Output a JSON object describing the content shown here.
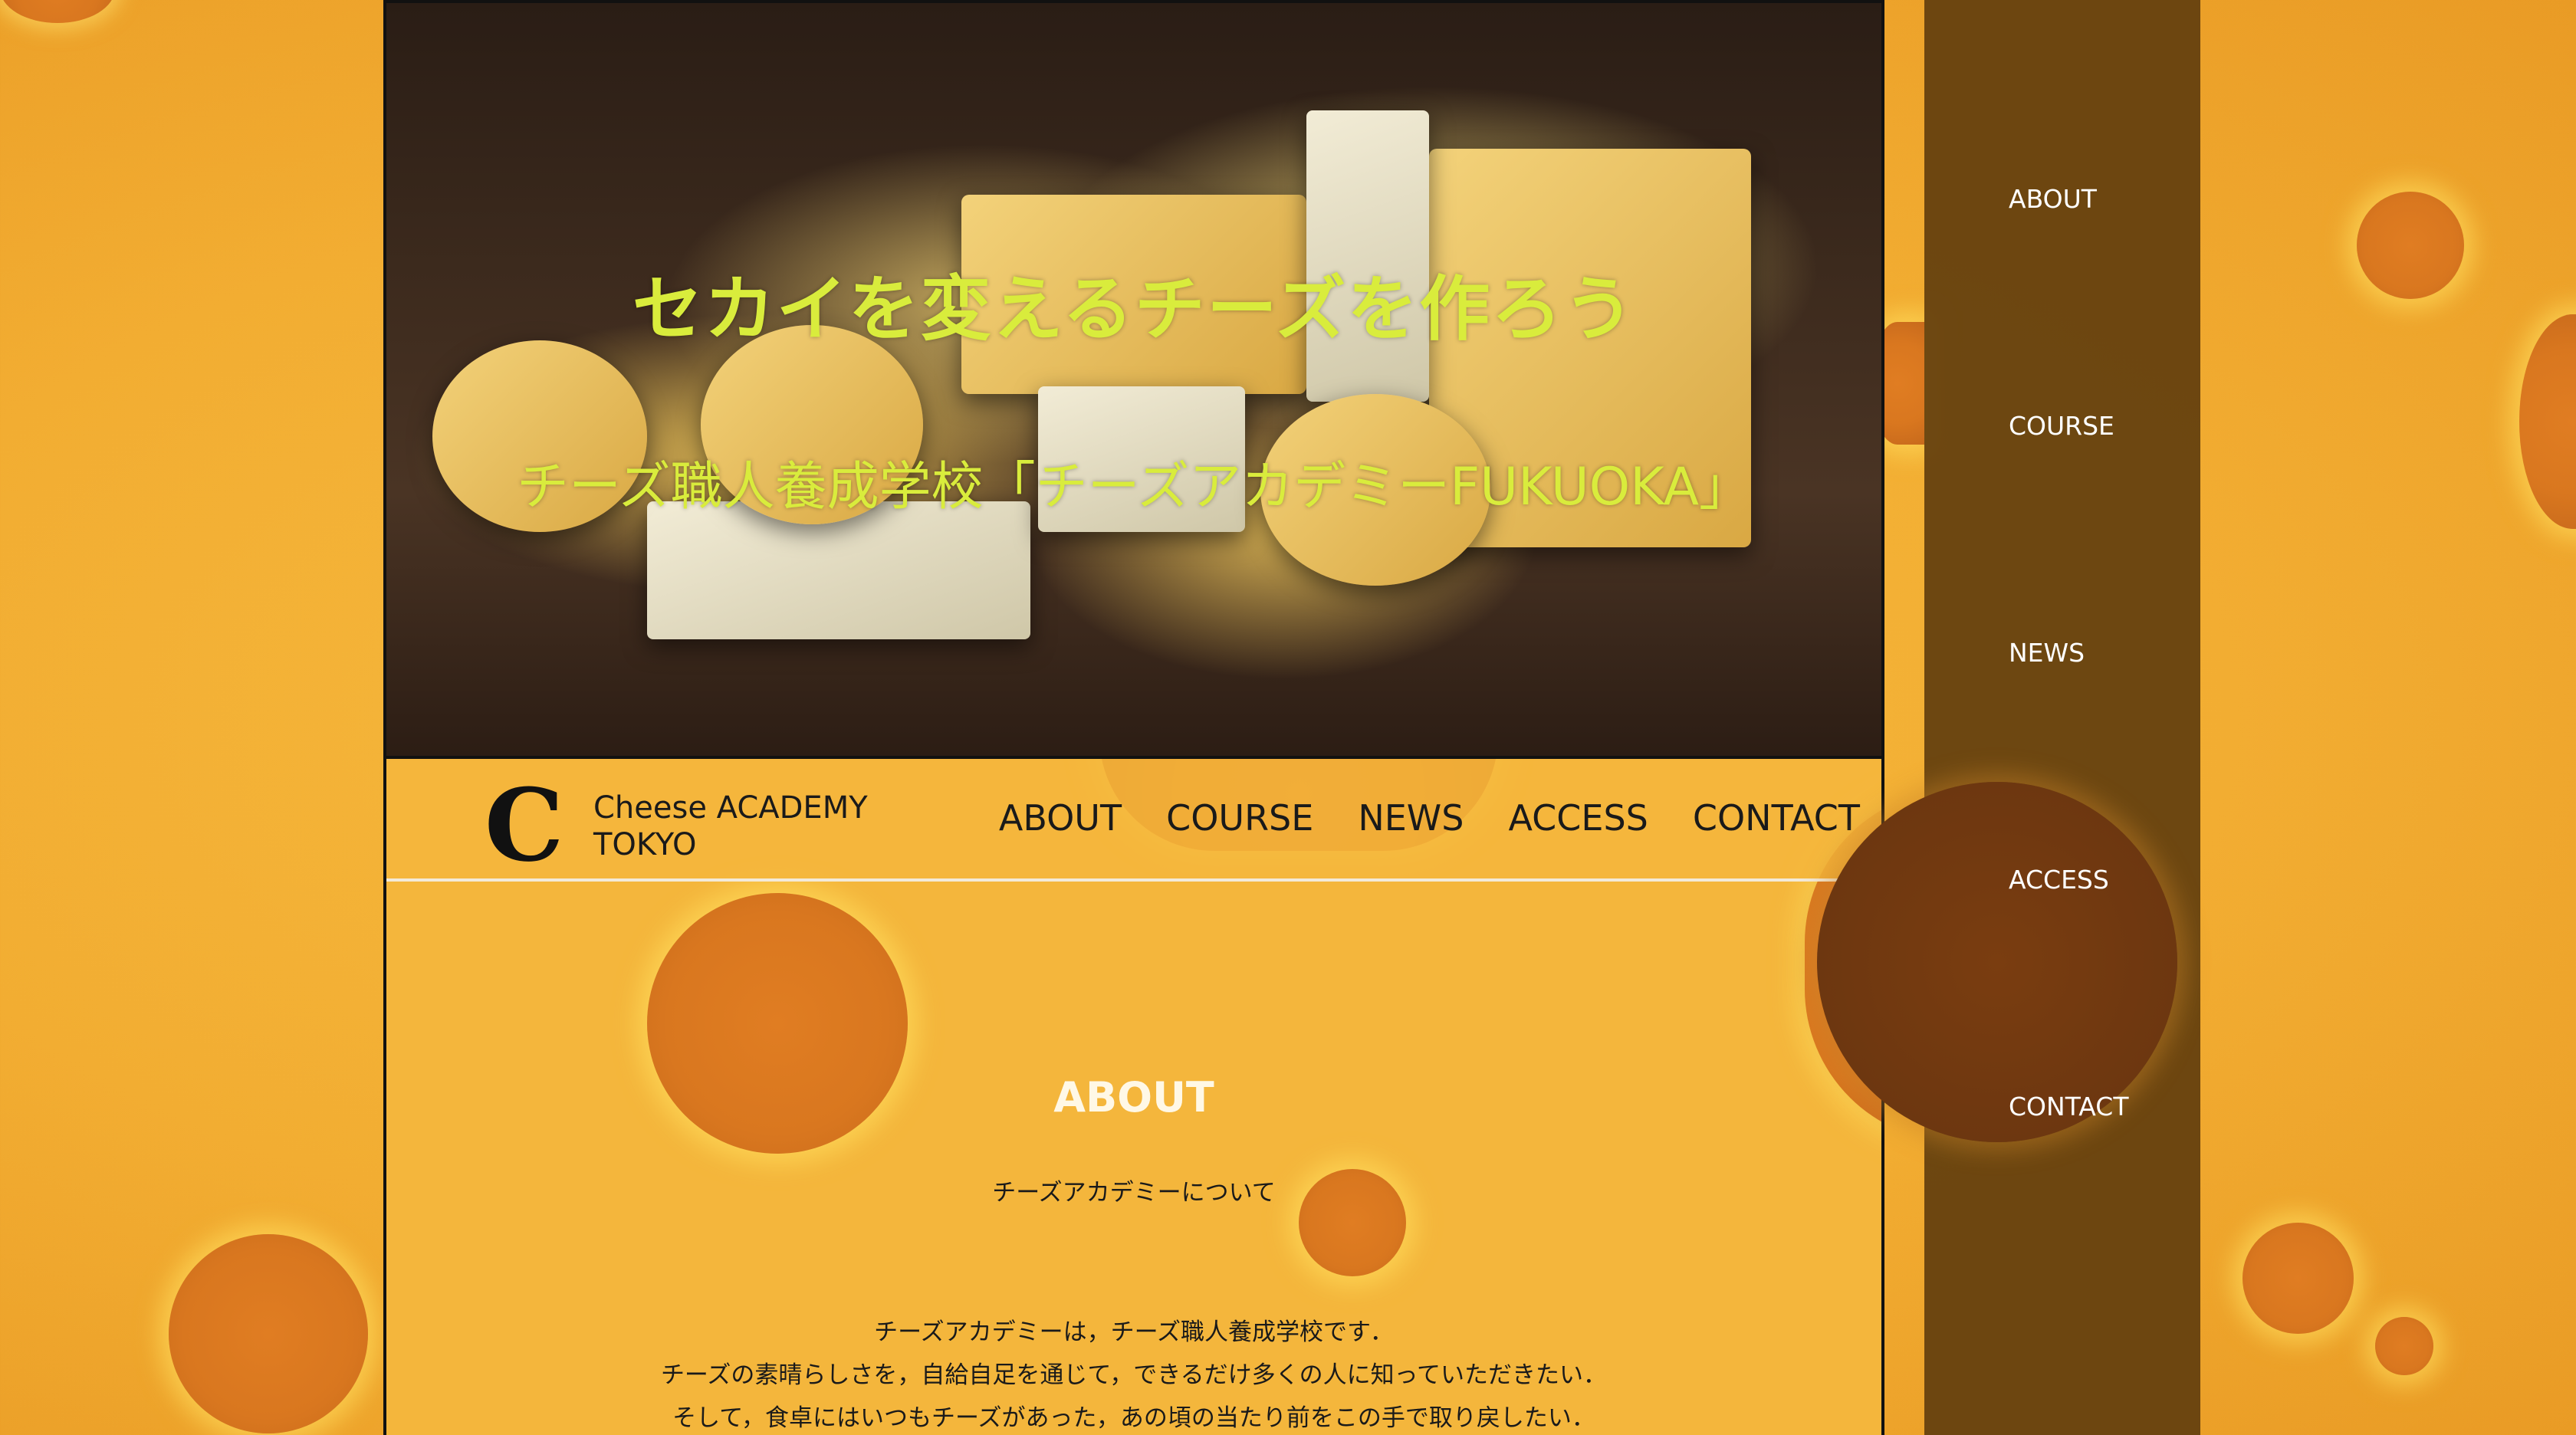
{
  "hero": {
    "title": "セカイを変えるチーズを作ろう",
    "subtitle": "チーズ職人養成学校「チーズアカデミーFUKUOKA」"
  },
  "header": {
    "logo_mark": "C",
    "logo_line1": "Cheese ACADEMY",
    "logo_line2": "TOKYO",
    "nav": [
      "ABOUT",
      "COURSE",
      "NEWS",
      "ACCESS",
      "CONTACT"
    ]
  },
  "about": {
    "title": "ABOUT",
    "subtitle": "チーズアカデミーについて",
    "body": [
      "チーズアカデミーは，チーズ職人養成学校です．",
      "チーズの素晴らしさを，自給自足を通じて，できるだけ多くの人に知っていただきたい．",
      "そして，食卓にはいつもチーズがあった，あの頃の当たり前をこの手で取り戻したい．"
    ]
  },
  "drawer": {
    "items": [
      "ABOUT",
      "COURSE",
      "NEWS",
      "ACCESS",
      "CONTACT"
    ]
  },
  "colors": {
    "background": "#f2ad32",
    "hole": "#d9771f",
    "hero_text": "#d9ec3c",
    "drawer": "#623e0e"
  }
}
